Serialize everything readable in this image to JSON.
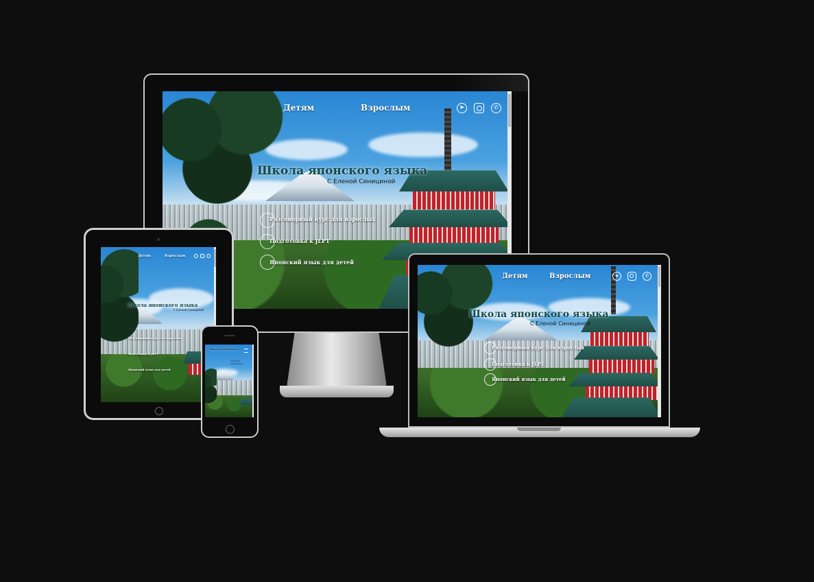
{
  "site": {
    "nav": {
      "kids": "Детям",
      "adults": "Взрослым"
    },
    "social_icons": [
      "telegram-icon",
      "instagram-icon",
      "whatsapp-icon"
    ],
    "title": "Школа японского языка",
    "subtitle": "С Еленой Синициной",
    "courses": [
      {
        "label": "Разговорный курс для взрослых"
      },
      {
        "label": "Подготовка к JLPT"
      },
      {
        "label": "Японский язык для детей"
      }
    ]
  },
  "phone": {
    "title": "Школа японского",
    "subtitle": "С Еленой Синициной"
  },
  "colors": {
    "background": "#0f0e0f",
    "title": "#154a4a",
    "pagoda_red": "#c4202a"
  }
}
